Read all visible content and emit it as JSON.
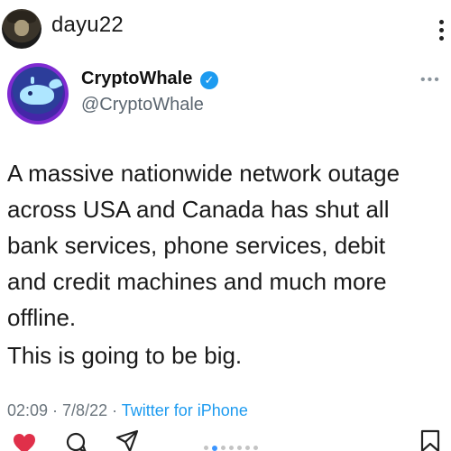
{
  "post": {
    "username": "dayu22"
  },
  "tweet": {
    "display_name": "CryptoWhale",
    "verified_mark": "✓",
    "handle": "@CryptoWhale",
    "more": "•••",
    "body_lines": [
      "A massive nationwide network outage",
      "across USA and Canada has shut all",
      "bank services, phone services, debit",
      "and credit machines and much more",
      "offline."
    ],
    "body_second": "This is going to be big.",
    "time": "02:09 · 7/8/22 · ",
    "source": "Twitter for iPhone"
  },
  "carousel": {
    "count": 7,
    "active_index": 1
  },
  "icons": {
    "like": "heart-icon",
    "comment": "comment-icon",
    "share": "send-icon",
    "save": "bookmark-icon",
    "more": "more-vertical-icon"
  },
  "colors": {
    "heart": "#e0304a",
    "verified": "#1d9bf0",
    "link": "#1d9bf0",
    "carousel_active": "#3d96ff"
  }
}
